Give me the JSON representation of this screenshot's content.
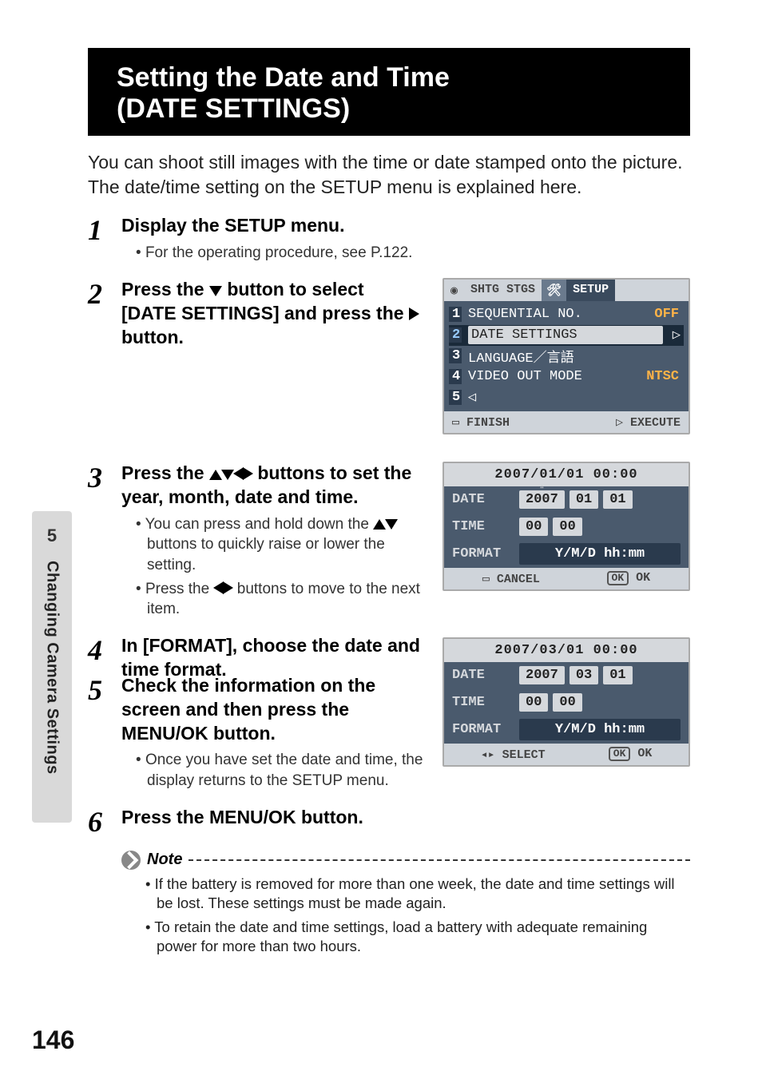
{
  "side_tab": {
    "number": "5",
    "label": "Changing Camera Settings"
  },
  "page_number": "146",
  "title_line1": "Setting the Date and Time",
  "title_line2": "(DATE SETTINGS)",
  "intro_line1": "You can shoot still images with the time or date stamped onto the picture.",
  "intro_line2": "The date/time setting on the SETUP menu is explained here.",
  "steps": {
    "s1": {
      "heading": "Display the SETUP menu.",
      "bullet1": "For the operating procedure, see P.122."
    },
    "s2": {
      "heading_a": "Press the ",
      "heading_b": " button to select [DATE SETTINGS] and press the ",
      "heading_c": " button."
    },
    "s3": {
      "heading_a": "Press the ",
      "heading_b": " buttons to set the year, month, date and time.",
      "bullet1_a": "You can press and hold down the ",
      "bullet1_b": " buttons to quickly raise or lower the setting.",
      "bullet2_a": "Press the ",
      "bullet2_b": " buttons to move to the next item."
    },
    "s4": {
      "heading": "In [FORMAT], choose the date and time format."
    },
    "s5": {
      "heading": "Check the information on the screen and then press the MENU/OK button.",
      "bullet1": "Once you have set the date and time, the display returns to the SETUP menu."
    },
    "s6": {
      "heading": "Press the MENU/OK button."
    }
  },
  "note": {
    "label": "Note",
    "li1": "If the battery is removed for more than one week, the date and time settings will be lost. These settings must be made again.",
    "li2": "To retain the date and time settings, load a battery with adequate remaining power for more than two hours."
  },
  "shot_setup": {
    "tab_shtg": "SHTG STGS",
    "tab_setup": "SETUP",
    "items": [
      {
        "idx": "1",
        "label": "SEQUENTIAL NO.",
        "value": "OFF"
      },
      {
        "idx": "2",
        "label": "DATE SETTINGS",
        "value": "",
        "selected": true,
        "arrow": true
      },
      {
        "idx": "3",
        "label": "LANGUAGE／言語",
        "value": ""
      },
      {
        "idx": "4",
        "label": "VIDEO OUT MODE",
        "value": "NTSC"
      },
      {
        "idx": "5",
        "label": "",
        "value": "",
        "caret": true
      }
    ],
    "footer_left": "FINISH",
    "footer_right": "EXECUTE"
  },
  "shot_date1": {
    "header": "2007/01/01 00:00",
    "date_label": "DATE",
    "date_y": "2007",
    "date_m": "01",
    "date_d": "01",
    "time_label": "TIME",
    "time_h": "00",
    "time_m": "00",
    "format_label": "FORMAT",
    "format_value": "Y/M/D hh:mm",
    "footer_left": "CANCEL",
    "footer_right": "OK"
  },
  "shot_date2": {
    "header": "2007/03/01 00:00",
    "date_label": "DATE",
    "date_y": "2007",
    "date_m": "03",
    "date_d": "01",
    "time_label": "TIME",
    "time_h": "00",
    "time_m": "00",
    "format_label": "FORMAT",
    "format_value": "Y/M/D hh:mm",
    "footer_left": "SELECT",
    "footer_right": "OK"
  }
}
